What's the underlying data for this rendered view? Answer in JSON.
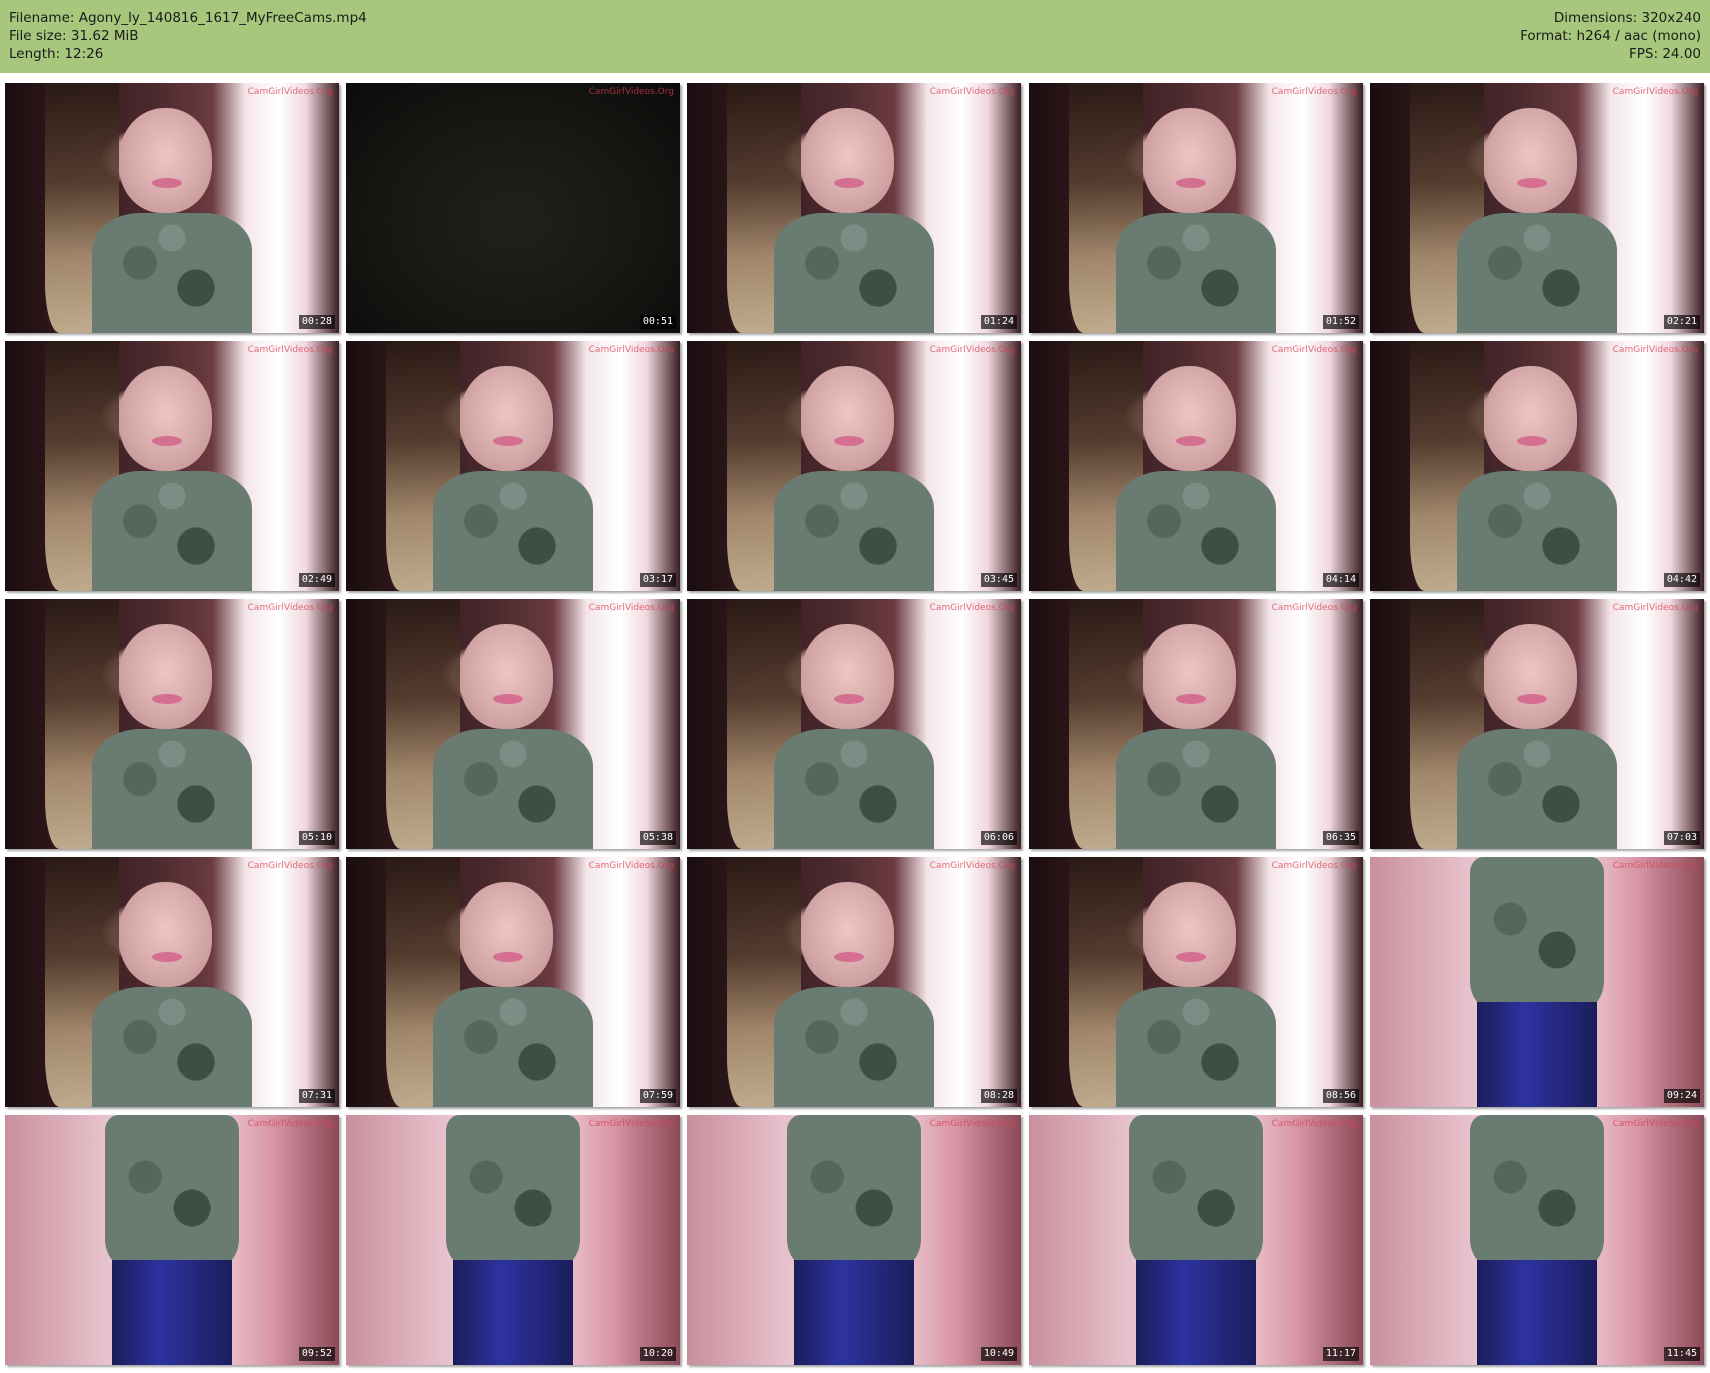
{
  "header": {
    "filename": "Filename: Agony_ly_140816_1617_MyFreeCams.mp4",
    "file_size": "File size: 31.62 MiB",
    "length": "Length: 12:26",
    "dimensions": "Dimensions: 320x240",
    "format": "Format: h264 / aac (mono)",
    "fps": "FPS: 24.00"
  },
  "watermark": "CamGirlVideos.Org",
  "thumbnails": [
    {
      "time": "00:28",
      "scene": "cam"
    },
    {
      "time": "00:51",
      "scene": "dark"
    },
    {
      "time": "01:24",
      "scene": "cam"
    },
    {
      "time": "01:52",
      "scene": "cam"
    },
    {
      "time": "02:21",
      "scene": "cam"
    },
    {
      "time": "02:49",
      "scene": "cam"
    },
    {
      "time": "03:17",
      "scene": "cam"
    },
    {
      "time": "03:45",
      "scene": "cam"
    },
    {
      "time": "04:14",
      "scene": "cam"
    },
    {
      "time": "04:42",
      "scene": "cam"
    },
    {
      "time": "05:10",
      "scene": "cam"
    },
    {
      "time": "05:38",
      "scene": "cam"
    },
    {
      "time": "06:06",
      "scene": "cam"
    },
    {
      "time": "06:35",
      "scene": "cam"
    },
    {
      "time": "07:03",
      "scene": "cam"
    },
    {
      "time": "07:31",
      "scene": "cam"
    },
    {
      "time": "07:59",
      "scene": "cam"
    },
    {
      "time": "08:28",
      "scene": "cam"
    },
    {
      "time": "08:56",
      "scene": "cam"
    },
    {
      "time": "09:24",
      "scene": "body"
    },
    {
      "time": "09:52",
      "scene": "body"
    },
    {
      "time": "10:20",
      "scene": "body"
    },
    {
      "time": "10:49",
      "scene": "body"
    },
    {
      "time": "11:17",
      "scene": "body"
    },
    {
      "time": "11:45",
      "scene": "body"
    }
  ]
}
